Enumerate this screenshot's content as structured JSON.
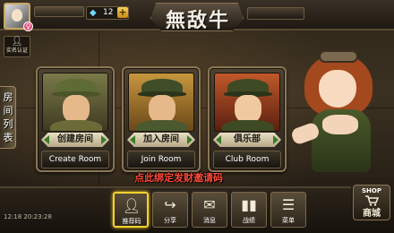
{
  "top_bar": {
    "diamond_count": "12",
    "logo_text": "無敌牛",
    "add_symbol": "+",
    "gender_symbol": "♀"
  },
  "realname": {
    "label": "实名认证"
  },
  "side_tab": {
    "label": "房间列表"
  },
  "cards": [
    {
      "label": "创建房间",
      "en_label": "Create Room"
    },
    {
      "label": "加入房间",
      "en_label": "Join Room"
    },
    {
      "label": "俱乐部",
      "en_label": "Club Room"
    }
  ],
  "hint": "点此绑定发财邀请码",
  "status": {
    "clock": "12:18  20:23:28"
  },
  "toolbar": [
    {
      "label": "推荐码",
      "icon": "person-icon"
    },
    {
      "label": "分享",
      "icon": "share-icon"
    },
    {
      "label": "消息",
      "icon": "mail-icon"
    },
    {
      "label": "战绩",
      "icon": "bar-chart-icon"
    },
    {
      "label": "菜单",
      "icon": "menu-icon"
    }
  ],
  "shop": {
    "label": "SHOP",
    "cn_label": "商城"
  },
  "colors": {
    "hint": "#ff4a3a",
    "highlight": "#f6d12e",
    "frame": "#8a7656"
  }
}
